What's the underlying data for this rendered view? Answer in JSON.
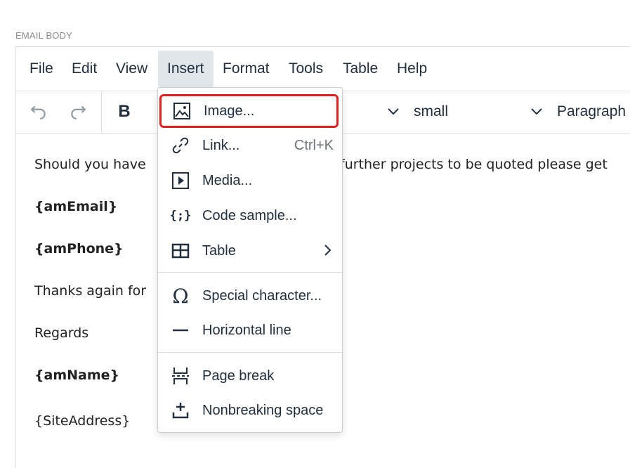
{
  "field_label": "EMAIL BODY",
  "menubar": {
    "items": [
      {
        "label": "File"
      },
      {
        "label": "Edit"
      },
      {
        "label": "View"
      },
      {
        "label": "Insert",
        "active": true
      },
      {
        "label": "Format"
      },
      {
        "label": "Tools"
      },
      {
        "label": "Table"
      },
      {
        "label": "Help"
      }
    ]
  },
  "toolbar": {
    "undo_icon": "undo-icon",
    "redo_icon": "redo-icon",
    "bold_label": "B",
    "font_size_value": "small",
    "block_format_value": "Paragraph"
  },
  "content": {
    "paragraphs": [
      {
        "text": "Should you have",
        "bold": false
      },
      {
        "text": "{amEmail}",
        "bold": true
      },
      {
        "text": "{amPhone}",
        "bold": true
      },
      {
        "text": "Thanks again for",
        "bold": false
      },
      {
        "text": "Regards",
        "bold": false
      },
      {
        "text": "{amName}",
        "bold": true
      },
      {
        "text": "{SiteAddress}",
        "bold": false
      }
    ],
    "visible_tail": "further projects to be quoted please get"
  },
  "insert_menu": {
    "items": [
      {
        "label": "Image...",
        "icon": "image-icon",
        "highlighted": true
      },
      {
        "label": "Link...",
        "icon": "link-icon",
        "shortcut": "Ctrl+K"
      },
      {
        "label": "Media...",
        "icon": "media-icon"
      },
      {
        "label": "Code sample...",
        "icon": "code-sample-icon"
      },
      {
        "label": "Table",
        "icon": "table-icon",
        "submenu": true
      },
      {
        "label": "Special character...",
        "icon": "omega-icon"
      },
      {
        "label": "Horizontal line",
        "icon": "horizontal-line-icon"
      },
      {
        "label": "Page break",
        "icon": "page-break-icon"
      },
      {
        "label": "Nonbreaking space",
        "icon": "nonbreaking-space-icon"
      }
    ]
  },
  "colors": {
    "highlight_border": "#e02020",
    "active_menu_bg": "#e1e6ea",
    "text": "#222f3e"
  }
}
